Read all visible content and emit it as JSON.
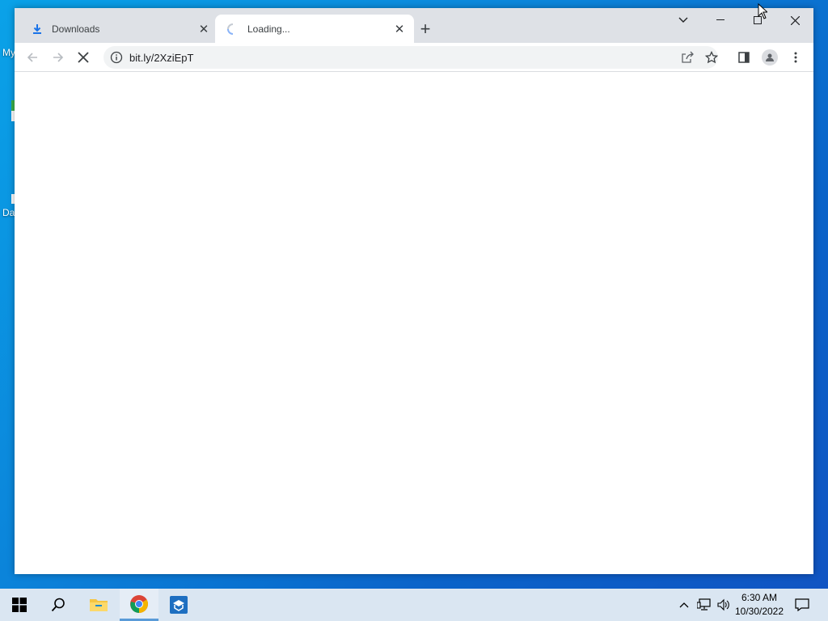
{
  "desktop": {
    "label_top": "My",
    "label_bottom": "Da"
  },
  "browser": {
    "tabs": [
      {
        "title": "Downloads",
        "icon": "download-icon",
        "active": false
      },
      {
        "title": "Loading...",
        "icon": "loading-spinner-icon",
        "active": true
      }
    ],
    "address": "bit.ly/2XziEpT",
    "toolbar_icons": [
      "back-icon",
      "forward-icon",
      "stop-icon",
      "site-info-icon",
      "share-icon",
      "bookmark-star-icon",
      "side-panel-icon",
      "profile-icon",
      "menu-icon"
    ],
    "window_controls": [
      "tab-search-icon",
      "minimize-icon",
      "maximize-icon",
      "close-icon"
    ]
  },
  "taskbar": {
    "items": [
      "windows-start-icon",
      "search-icon",
      "file-explorer-icon",
      "chrome-icon",
      "app-icon"
    ],
    "tray_icons": [
      "chevron-up-icon",
      "network-icon",
      "volume-icon",
      "notification-icon"
    ],
    "time": "6:30 AM",
    "date": "10/30/2022"
  },
  "colors": {
    "tabstrip": "#dee1e6",
    "omnibox": "#f1f3f4",
    "taskbar": "#dae6f2",
    "accent": "#1a73e8"
  }
}
